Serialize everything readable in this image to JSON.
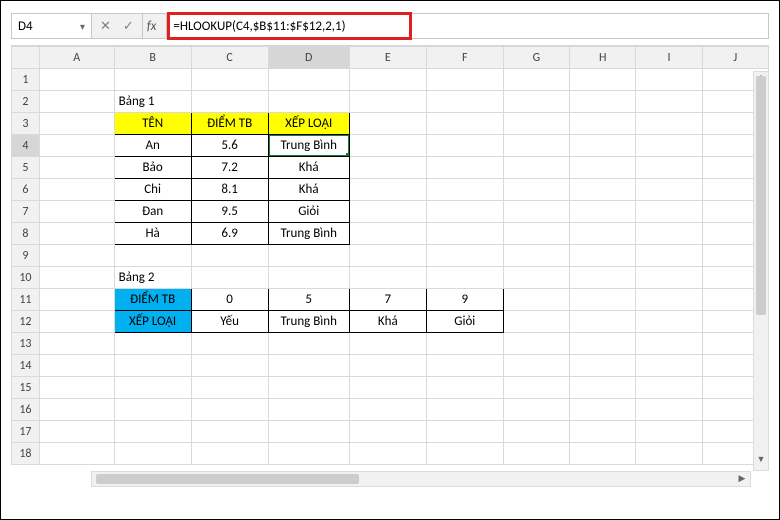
{
  "name_box": "D4",
  "formula": "=HLOOKUP(C4,$B$11:$F$12,2,1)",
  "columns": [
    "A",
    "B",
    "C",
    "D",
    "E",
    "F",
    "G",
    "H",
    "I",
    "J"
  ],
  "rows": [
    "1",
    "2",
    "3",
    "4",
    "5",
    "6",
    "7",
    "8",
    "9",
    "10",
    "11",
    "12",
    "13",
    "14",
    "15",
    "16",
    "17",
    "18"
  ],
  "active_col": "D",
  "active_row": "4",
  "table1_title": "Bảng 1",
  "table1_headers": {
    "name": "TÊN",
    "score": "ĐIỂM TB",
    "rank": "XẾP LOẠI"
  },
  "table1_rows": [
    {
      "name": "An",
      "score": "5.6",
      "rank": "Trung Bình"
    },
    {
      "name": "Bảo",
      "score": "7.2",
      "rank": "Khá"
    },
    {
      "name": "Chi",
      "score": "8.1",
      "rank": "Khá"
    },
    {
      "name": "Đan",
      "score": "9.5",
      "rank": "Giỏi"
    },
    {
      "name": "Hà",
      "score": "6.9",
      "rank": "Trung Bình"
    }
  ],
  "table2_title": "Bảng 2",
  "table2_row1": {
    "label": "ĐIỂM TB",
    "v0": "0",
    "v1": "5",
    "v2": "7",
    "v3": "9"
  },
  "table2_row2": {
    "label": "XẾP LOẠI",
    "v0": "Yếu",
    "v1": "Trung Bình",
    "v2": "Khá",
    "v3": "Giỏi"
  },
  "fb_icons": {
    "cancel": "✕",
    "confirm": "✓",
    "fx": "fx",
    "dd": "▾"
  },
  "scroll_arrows": {
    "up": "▲",
    "down": "▼",
    "left": "◀",
    "right": "▶"
  }
}
